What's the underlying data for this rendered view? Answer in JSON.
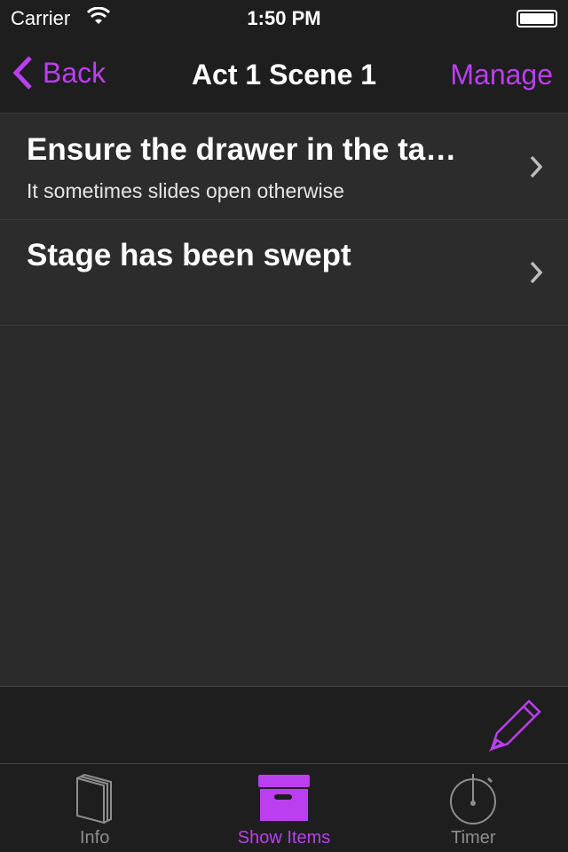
{
  "status": {
    "carrier": "Carrier",
    "time": "1:50 PM",
    "battery_percent": 100
  },
  "nav": {
    "back": "Back",
    "title": "Act 1 Scene 1",
    "manage": "Manage"
  },
  "items": [
    {
      "title": "Ensure the drawer in the ta…",
      "subtitle": "It sometimes slides open otherwise"
    },
    {
      "title": "Stage has been swept",
      "subtitle": ""
    }
  ],
  "tabs": [
    {
      "label": "Info",
      "icon": "book-icon"
    },
    {
      "label": "Show Items",
      "icon": "box-icon",
      "active": true
    },
    {
      "label": "Timer",
      "icon": "stopwatch-icon"
    }
  ],
  "colors": {
    "accent": "#bb3ff0",
    "bar": "#1e1e1e",
    "list": "#2c2c2c"
  }
}
